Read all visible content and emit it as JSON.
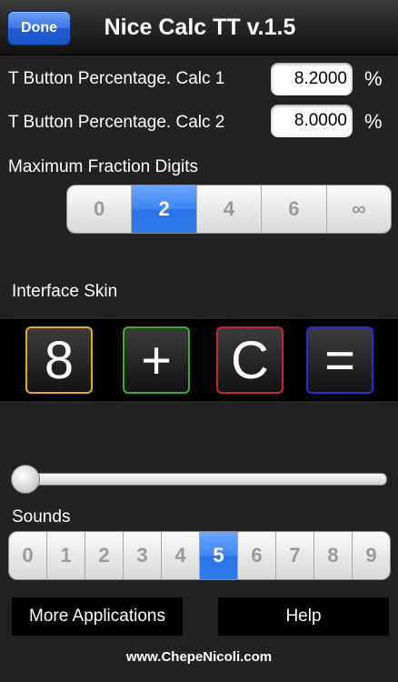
{
  "nav": {
    "done_label": "Done",
    "title": "Nice Calc TT v.1.5"
  },
  "calc1": {
    "label": "T Button Percentage. Calc 1",
    "value": "8.2000",
    "unit": "%"
  },
  "calc2": {
    "label": "T Button Percentage. Calc 2",
    "value": "8.0000",
    "unit": "%"
  },
  "fraction": {
    "label": "Maximum Fraction Digits",
    "options": [
      "0",
      "2",
      "4",
      "6",
      "∞"
    ],
    "selected": "2"
  },
  "skin": {
    "label": "Interface Skin",
    "keys": [
      {
        "label": "8",
        "border_color": "#e0a830"
      },
      {
        "label": "+",
        "border_color": "#3fa83a"
      },
      {
        "label": "C",
        "border_color": "#c62828"
      },
      {
        "label": "=",
        "border_color": "#2a2ad6"
      }
    ],
    "slider_level": 0
  },
  "sounds": {
    "label": "Sounds",
    "options": [
      "0",
      "1",
      "2",
      "3",
      "4",
      "5",
      "6",
      "7",
      "8",
      "9"
    ],
    "selected": "5"
  },
  "buttons": {
    "more_apps": "More Applications",
    "help": "Help"
  },
  "footer": {
    "link": "www.ChepeNicoli.com"
  },
  "colors": {
    "accent": "#3e86f4",
    "background": "#222222"
  }
}
